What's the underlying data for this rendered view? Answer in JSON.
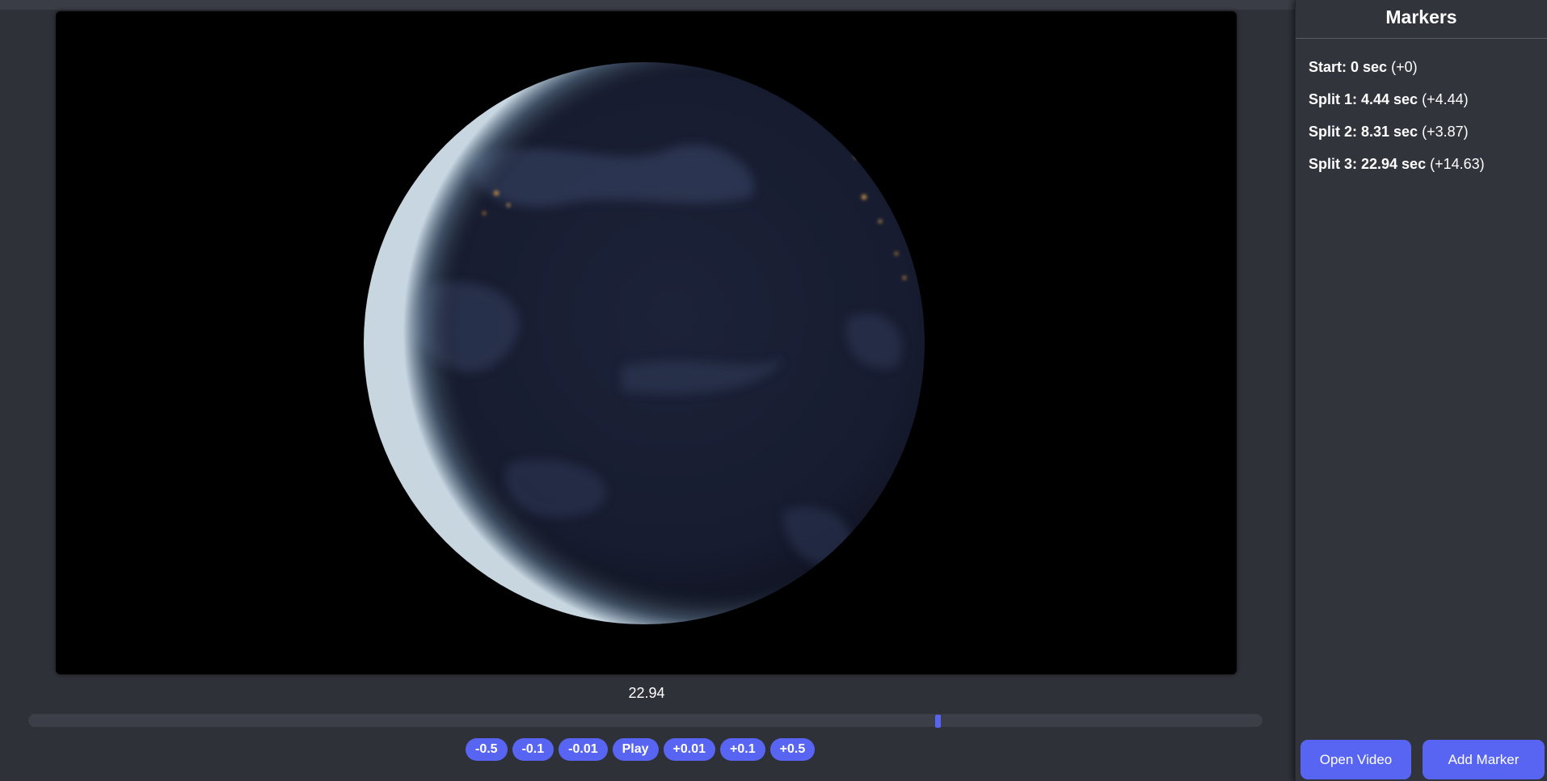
{
  "player": {
    "current_time": "22.94",
    "progress_fraction": 0.738
  },
  "controls": [
    {
      "name": "step-back-0-5-button",
      "label": "-0.5"
    },
    {
      "name": "step-back-0-1-button",
      "label": "-0.1"
    },
    {
      "name": "step-back-0-01-button",
      "label": "-0.01"
    },
    {
      "name": "play-button",
      "label": "Play"
    },
    {
      "name": "step-forward-0-01-button",
      "label": "+0.01"
    },
    {
      "name": "step-forward-0-1-button",
      "label": "+0.1"
    },
    {
      "name": "step-forward-0-5-button",
      "label": "+0.5"
    }
  ],
  "sidebar": {
    "title": "Markers",
    "markers": [
      {
        "label": "Start: 0 sec",
        "delta": "(+0)"
      },
      {
        "label": "Split 1: 4.44 sec",
        "delta": "(+4.44)"
      },
      {
        "label": "Split 2: 8.31 sec",
        "delta": "(+3.87)"
      },
      {
        "label": "Split 3: 22.94 sec",
        "delta": "(+14.63)"
      }
    ],
    "open_video_label": "Open Video",
    "add_marker_label": "Add Marker"
  },
  "colors": {
    "accent": "#5865f2",
    "background": "#2f3139",
    "sidebar": "#32343c"
  }
}
